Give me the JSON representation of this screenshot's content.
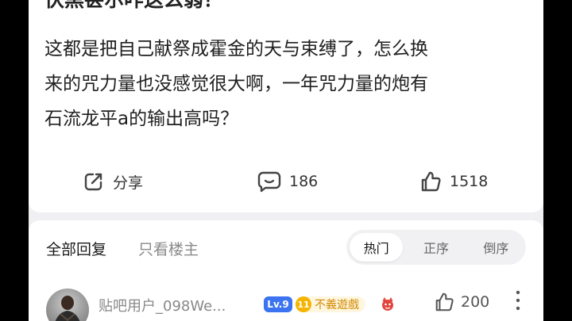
{
  "post": {
    "title_partial": "伏黑甚尔咋这么弱？",
    "body_lines": [
      "这都是把自己献祭成霍金的天与束缚了，怎么换",
      "来的咒力量也没感觉很大啊，一年咒力量的炮有",
      "石流龙平a的输出高吗？"
    ]
  },
  "actions": {
    "share": {
      "icon": "share-icon",
      "label": "分享"
    },
    "comments": {
      "icon": "comment-icon",
      "count": "186"
    },
    "likes": {
      "icon": "thumbs-up-icon",
      "count": "1518"
    }
  },
  "replies": {
    "tab_all": "全部回复",
    "tab_host_only": "只看楼主",
    "sort_options": [
      "热门",
      "正序",
      "倒序"
    ],
    "sort_selected": "热门"
  },
  "comment": {
    "username": "贴吧用户_098We...",
    "level_badge": "Lv.9",
    "fan_level": "11",
    "fan_title": "不義遊戲",
    "like_count": "200",
    "icons": {
      "avatar": "avatar",
      "fan_icon": "red-devil-icon",
      "like": "thumbs-up-icon",
      "more": "more-vertical-icon"
    }
  },
  "colors": {
    "level_badge_bg": "#3b73f0",
    "fan_badge_bg": "#f5b400",
    "page_bg": "#f0f0f2",
    "card_bg": "#ffffff"
  }
}
